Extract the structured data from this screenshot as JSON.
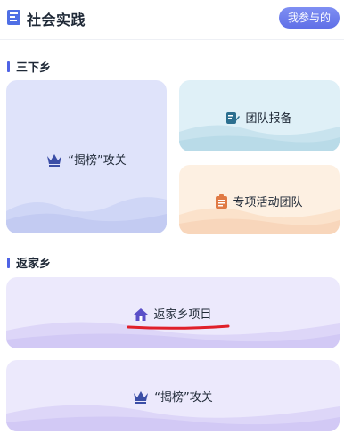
{
  "header": {
    "title": "社会实践",
    "my_button": "我参与的"
  },
  "sections": [
    {
      "title": "三下乡",
      "cards": [
        {
          "label": "“揭榜”攻关",
          "icon": "crown-icon"
        },
        {
          "label": "团队报备",
          "icon": "edit-document-icon"
        },
        {
          "label": "专项活动团队",
          "icon": "clipboard-icon"
        }
      ]
    },
    {
      "title": "返家乡",
      "cards": [
        {
          "label": "返家乡项目",
          "icon": "home-icon"
        },
        {
          "label": "“揭榜”攻关",
          "icon": "crown-icon"
        }
      ]
    }
  ],
  "colors": {
    "accent": "#5f6fe7",
    "crown": "#3b4ea6",
    "annotation": "#e0202a"
  }
}
